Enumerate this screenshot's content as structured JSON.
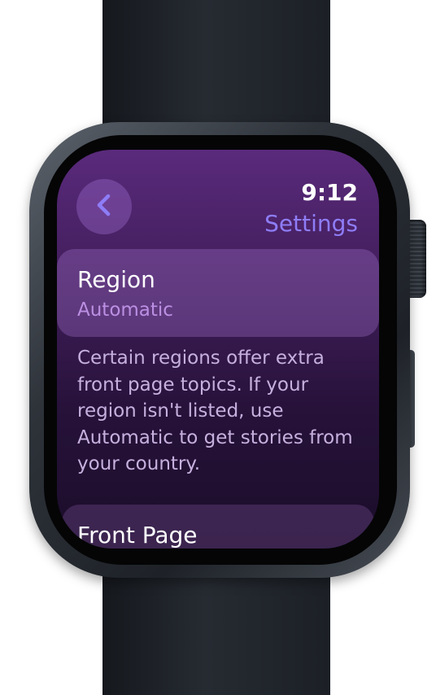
{
  "status_bar": {
    "time": "9:12"
  },
  "navigation": {
    "back_icon": "chevron-left-icon",
    "title": "Settings"
  },
  "settings_list": {
    "region": {
      "label": "Region",
      "value": "Automatic"
    },
    "region_footer": "Certain regions offer extra front page topics. If your region isn't listed, use Automatic to get stories from your country.",
    "front_page": {
      "label": "Front Page"
    }
  },
  "colors": {
    "accent": "#8e7df7",
    "secondary_value": "#bb8fe3",
    "background_top": "#5a2a7c",
    "background_bottom": "#1b0d29"
  }
}
